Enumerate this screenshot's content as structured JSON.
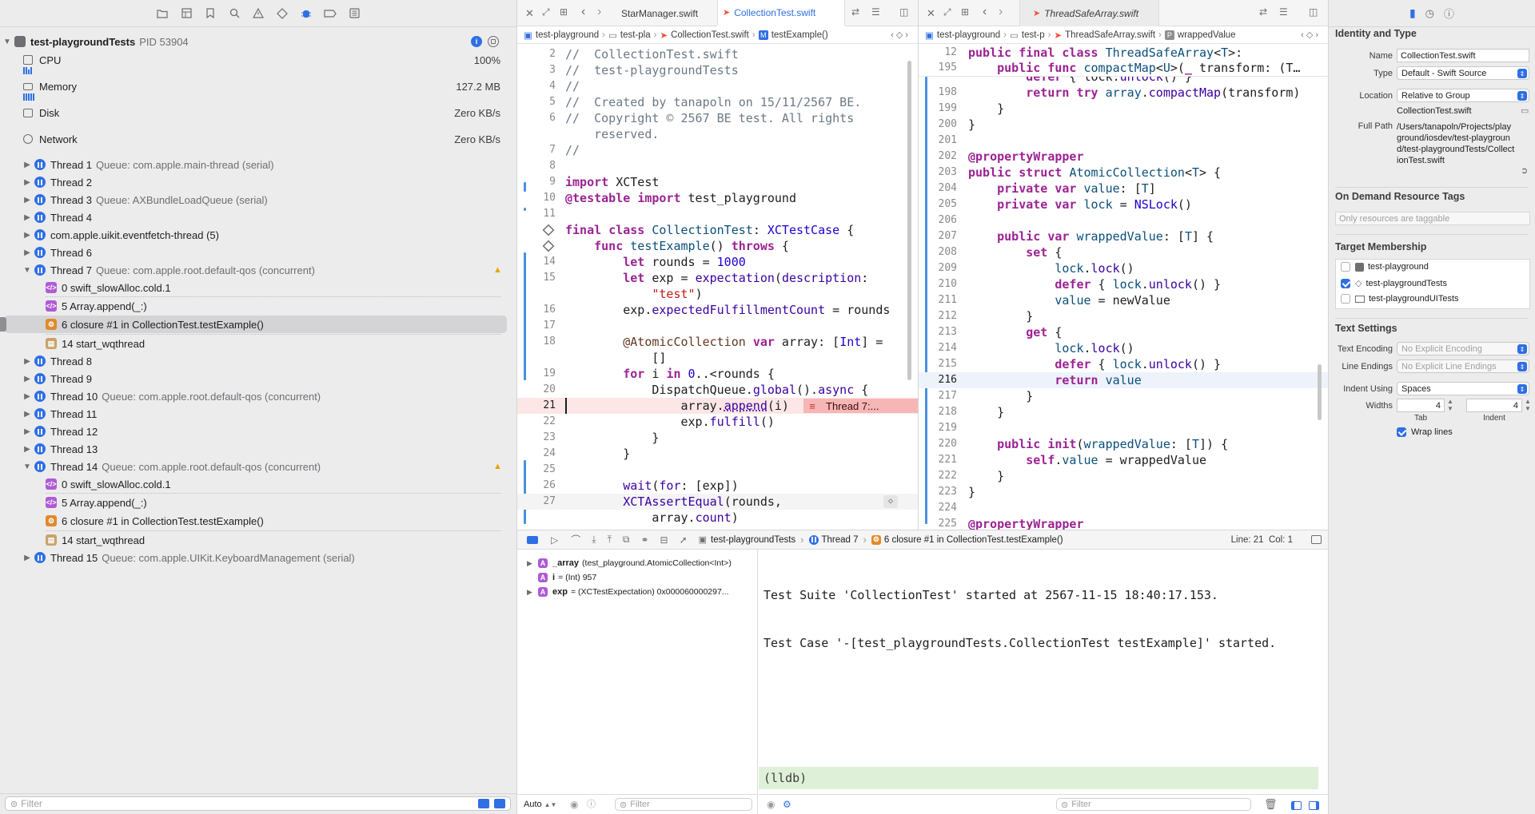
{
  "navigator": {
    "process": {
      "name": "test-playgroundTests",
      "pid": "PID 53904"
    },
    "gauges": [
      {
        "label": "CPU",
        "value": "100%"
      },
      {
        "label": "Memory",
        "value": "127.2 MB"
      },
      {
        "label": "Disk",
        "value": "Zero KB/s"
      },
      {
        "label": "Network",
        "value": "Zero KB/s"
      }
    ],
    "threads": [
      {
        "label": "Thread 1",
        "queue": "Queue: com.apple.main-thread (serial)"
      },
      {
        "label": "Thread 2",
        "queue": ""
      },
      {
        "label": "Thread 3",
        "queue": "Queue: AXBundleLoadQueue (serial)"
      },
      {
        "label": "Thread 4",
        "queue": ""
      },
      {
        "label": "com.apple.uikit.eventfetch-thread (5)",
        "queue": ""
      },
      {
        "label": "Thread 6",
        "queue": ""
      },
      {
        "label": "Thread 7",
        "queue": "Queue: com.apple.root.default-qos (concurrent)"
      },
      {
        "label": "Thread 8",
        "queue": ""
      },
      {
        "label": "Thread 9",
        "queue": ""
      },
      {
        "label": "Thread 10",
        "queue": "Queue: com.apple.root.default-qos (concurrent)"
      },
      {
        "label": "Thread 11",
        "queue": ""
      },
      {
        "label": "Thread 12",
        "queue": ""
      },
      {
        "label": "Thread 13",
        "queue": ""
      },
      {
        "label": "Thread 14",
        "queue": "Queue: com.apple.root.default-qos (concurrent)"
      },
      {
        "label": "Thread 15",
        "queue": "Queue: com.apple.UIKit.KeyboardManagement (serial)"
      }
    ],
    "thread7_frames": [
      "0 swift_slowAlloc.cold.1",
      "5 Array.append(_:)",
      "6 closure #1 in CollectionTest.testExample()",
      "14 start_wqthread"
    ],
    "thread14_frames": [
      "0 swift_slowAlloc.cold.1",
      "5 Array.append(_:)",
      "6 closure #1 in CollectionTest.testExample()",
      "14 start_wqthread"
    ],
    "filter_placeholder": "Filter"
  },
  "editor1": {
    "tabs": [
      "StarManager.swift",
      "CollectionTest.swift"
    ],
    "jumpbar": [
      "test-playground",
      "test-pla",
      "CollectionTest.swift",
      "testExample()"
    ],
    "issue": "Thread 7:..."
  },
  "editor2": {
    "tabs": [
      "ThreadSafeArray.swift"
    ],
    "jumpbar": [
      "test-playground",
      "test-p",
      "ThreadSafeArray.swift",
      "wrappedValue"
    ]
  },
  "debugbar": {
    "crumbs": [
      "test-playgroundTests",
      "Thread 7",
      "6 closure #1 in CollectionTest.testExample()"
    ],
    "position": "Line: 21  Col: 1"
  },
  "variables": [
    {
      "name": "_array",
      "detail": "(test_playground.AtomicCollection<Int>)"
    },
    {
      "name": "i",
      "detail": "= (Int) 957"
    },
    {
      "name": "exp",
      "detail": "= (XCTestExpectation) 0x000060000297..."
    }
  ],
  "console": {
    "lines": [
      "Test Suite 'CollectionTest' started at 2567-11-15 18:40:17.153.",
      "Test Case '-[test_playgroundTests.CollectionTest testExample]' started."
    ],
    "prompt": "(lldb)",
    "mode": "Auto",
    "filter_placeholder": "Filter"
  },
  "inspector": {
    "identity_title": "Identity and Type",
    "name_label": "Name",
    "name_value": "CollectionTest.swift",
    "type_label": "Type",
    "type_value": "Default - Swift Source",
    "location_label": "Location",
    "location_value": "Relative to Group",
    "location_file": "CollectionTest.swift",
    "fullpath_label": "Full Path",
    "fullpath_value": "/Users/tanapoln/Projects/playground/iosdev/test-playground/test-playgroundTests/CollectionTest.swift",
    "odr_title": "On Demand Resource Tags",
    "odr_placeholder": "Only resources are taggable",
    "target_title": "Target Membership",
    "targets": [
      {
        "name": "test-playground",
        "checked": false
      },
      {
        "name": "test-playgroundTests",
        "checked": true
      },
      {
        "name": "test-playgroundUITests",
        "checked": false
      }
    ],
    "text_title": "Text Settings",
    "encoding_label": "Text Encoding",
    "encoding_value": "No Explicit Encoding",
    "endings_label": "Line Endings",
    "endings_value": "No Explicit Line Endings",
    "indent_label": "Indent Using",
    "indent_value": "Spaces",
    "widths_label": "Widths",
    "tab_value": "4",
    "indent_value_num": "4",
    "tab_label": "Tab",
    "indent_label2": "Indent",
    "wrap_label": "Wrap lines"
  }
}
